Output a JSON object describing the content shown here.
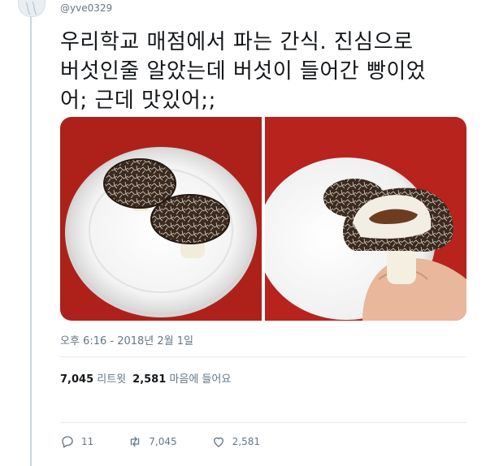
{
  "tweet": {
    "handle": "@yve0329",
    "text": "우리학교 매점에서 파는 간식. 진심으로\n버섯인줄 알았는데 버섯이 들어간 빵이었\n어; 근데 맛있어;;",
    "timestamp": "오후 6:16 - 2018년 2월 1일"
  },
  "stats": {
    "retweet_count": "7,045",
    "retweet_label": "리트윗",
    "like_count": "2,581",
    "like_label": "마음에 들어요"
  },
  "actions": {
    "reply_count": "11",
    "retweet_count": "7,045",
    "like_count": "2,581"
  },
  "icons": {
    "reply": "reply-icon",
    "retweet": "retweet-icon",
    "like": "heart-icon"
  },
  "colors": {
    "text": "#14171a",
    "secondary": "#657786",
    "divider": "#e6ecf0",
    "thread_line": "#ccd6dd",
    "table_red": "#b3221c"
  }
}
